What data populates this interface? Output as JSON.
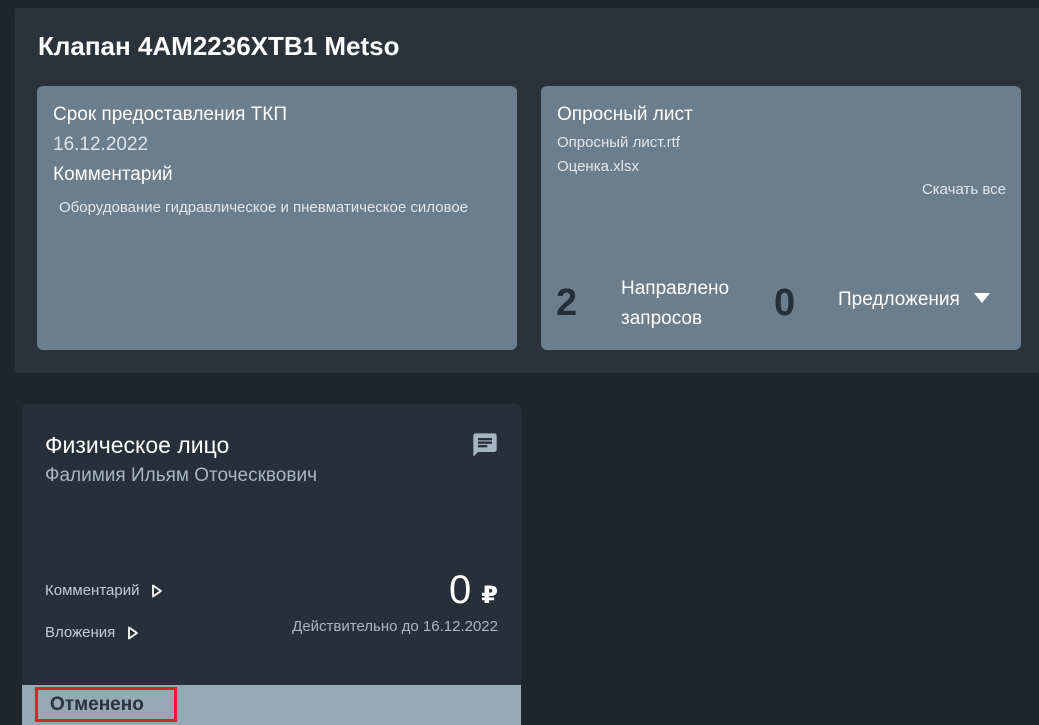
{
  "page": {
    "title": "Клапан 4AM2236XTB1 Metso"
  },
  "details": {
    "deadline_label": "Срок предоставления ТКП",
    "deadline_value": "16.12.2022",
    "comment_label": "Комментарий",
    "comment_value": "Оборудование гидравлическое и пневматическое силовое"
  },
  "questionnaire": {
    "label": "Опросный лист",
    "files": [
      "Опросный лист.rtf",
      "Оценка.xlsx"
    ],
    "download_all": "Скачать все",
    "requests_count": "2",
    "requests_label_line1": "Направлено",
    "requests_label_line2": "запросов",
    "offers_count": "0",
    "offers_label": "Предложения"
  },
  "offer": {
    "title": "Физическое лицо",
    "person": "Фалимия Ильям Оточесквович",
    "comment_link": "Комментарий",
    "attachments_link": "Вложения",
    "price": "0",
    "currency": "₽",
    "valid_until": "Действительно до 16.12.2022",
    "status": "Отменено"
  },
  "colors": {
    "background": "#1d252d",
    "info_card": "#6c7d8b",
    "offer_card": "#27303a",
    "status_bar": "#97a8b5",
    "status_highlight": "#e0202a"
  },
  "icons": {
    "chat": "chat-bubble-icon",
    "offers_toggle": "caret-down-icon",
    "expand": "caret-right-icon"
  }
}
